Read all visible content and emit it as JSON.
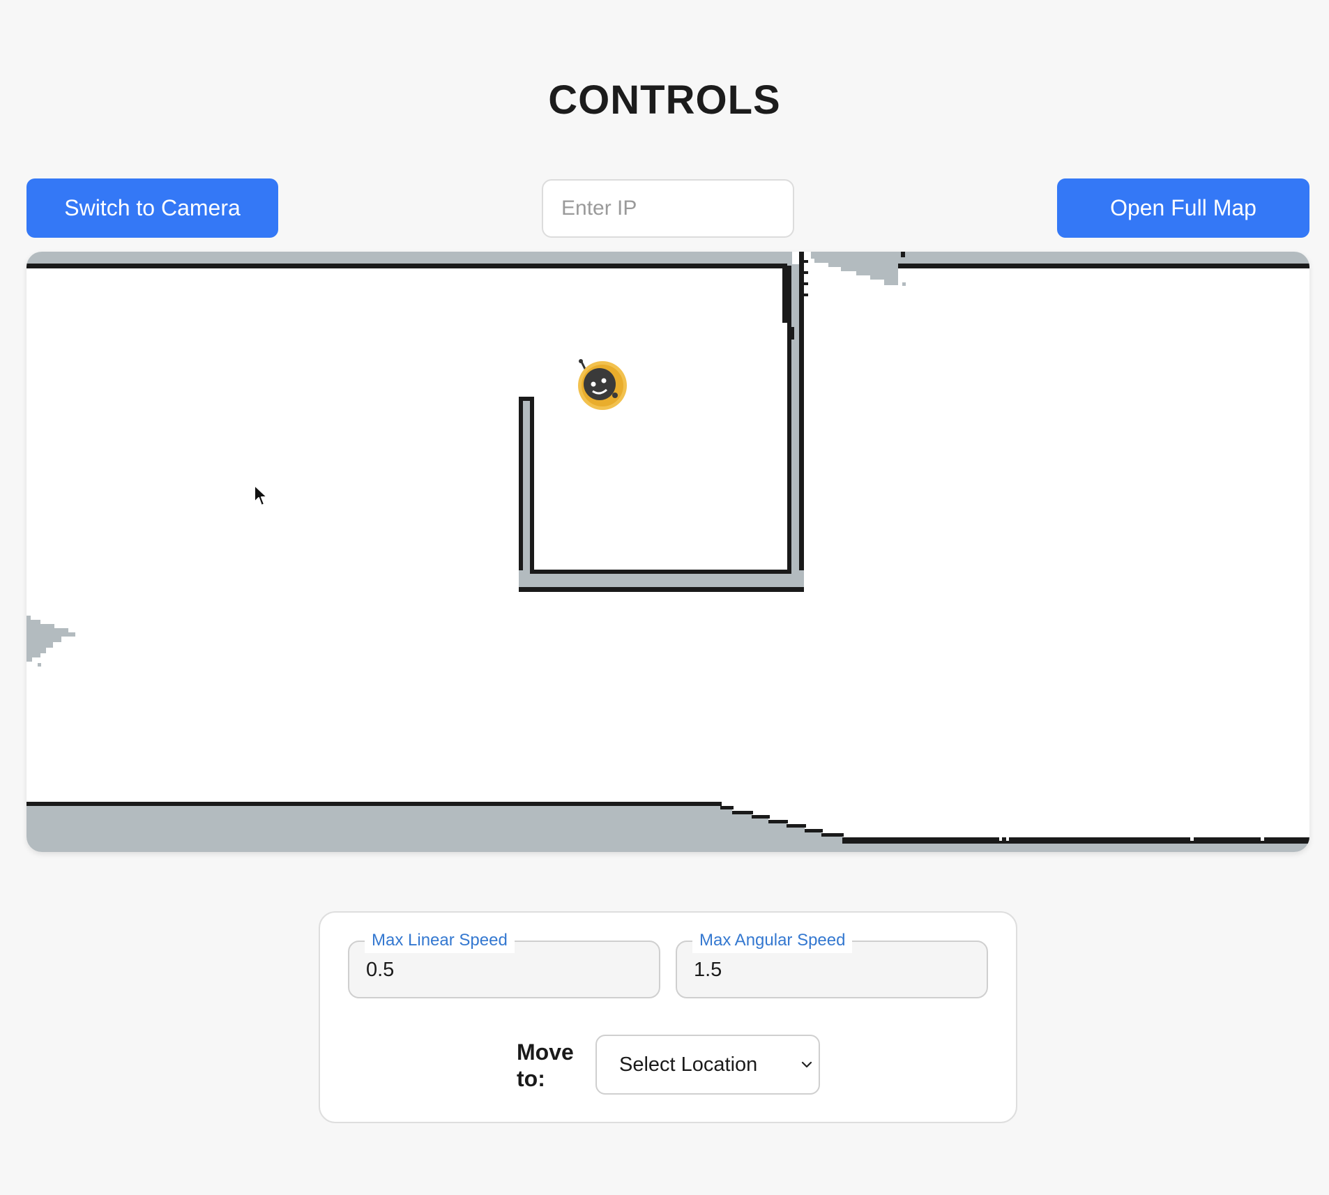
{
  "header": {
    "title": "CONTROLS"
  },
  "toolbar": {
    "switch_camera_label": "Switch to Camera",
    "ip_placeholder": "Enter IP",
    "ip_value": "",
    "open_map_label": "Open Full Map"
  },
  "map": {
    "robot_icon": "robot-bee-icon",
    "cursor_icon": "mouse-pointer-icon",
    "colors": {
      "wall": "#1a1a1a",
      "unknown": "#b3bbbf",
      "free": "#ffffff"
    }
  },
  "controls": {
    "max_linear_speed": {
      "label": "Max Linear Speed",
      "value": "0.5"
    },
    "max_angular_speed": {
      "label": "Max Angular Speed",
      "value": "1.5"
    },
    "move_to": {
      "label": "Move to:",
      "selected": "Select Location"
    }
  },
  "colors": {
    "accent": "#3478f6",
    "label_blue": "#3478d0",
    "background": "#f7f7f7"
  }
}
